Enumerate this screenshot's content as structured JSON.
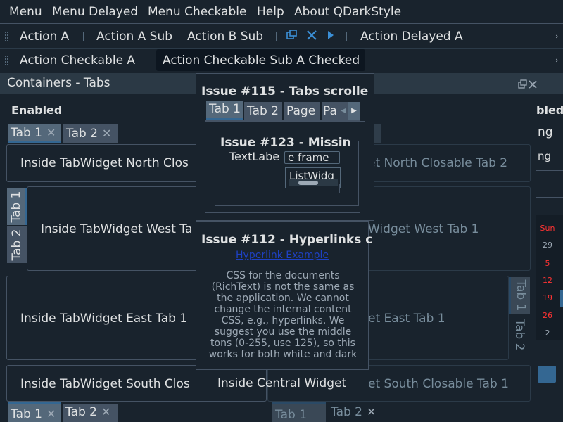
{
  "menubar": {
    "items": [
      "Menu",
      "Menu Delayed",
      "Menu Checkable",
      "Help",
      "About QDarkStyle"
    ]
  },
  "toolbar1": {
    "items": [
      "Action A",
      "Action A Sub",
      "Action B Sub",
      "Action Delayed A"
    ]
  },
  "toolbar2": {
    "items": [
      "Action Checkable A",
      "Action Checkable Sub A Checked"
    ]
  },
  "dock": {
    "title": "Containers - Tabs"
  },
  "left": {
    "section": "Enabled",
    "north": {
      "tabs": [
        "Tab 1",
        "Tab 2"
      ],
      "content": "Inside TabWidget North Clos"
    },
    "west": {
      "tabs": [
        "Tab 1",
        "Tab 2"
      ],
      "content": "Inside TabWidget West Ta"
    },
    "east": {
      "content": "Inside TabWidget East Tab 1"
    },
    "south": {
      "tabs": [
        "Tab 1",
        "Tab 2"
      ],
      "content": "Inside TabWidget South Clos"
    }
  },
  "right": {
    "section": "bled",
    "fragments": [
      "ng",
      "ng"
    ],
    "north": {
      "content": "et North Closable Tab 2"
    },
    "west": {
      "content": "Widget West Tab 1"
    },
    "east": {
      "tabs": [
        "Tab 1",
        "Tab 2"
      ],
      "content": "et East Tab 1"
    },
    "south": {
      "tabs": [
        "Tab 1",
        "Tab 2"
      ],
      "content": "et South Closable Tab 1"
    },
    "calendar": [
      "Sun",
      "29",
      "5",
      "12",
      "19",
      "26",
      "2"
    ]
  },
  "central": {
    "label": "Inside Central Widget"
  },
  "float115": {
    "title": "Issue #115 - Tabs scrolle",
    "tabs": [
      "Tab 1",
      "Tab 2",
      "Page",
      "Pa"
    ]
  },
  "float123": {
    "title": "Issue #123 - Missin",
    "label": "TextLabe",
    "field": "e frame",
    "list": "ListWidg"
  },
  "float112": {
    "title": "Issue #112 - Hyperlinks c",
    "link": "Hyperlink Example",
    "doc_lines": [
      "CSS for the documents",
      "(RichText) is not the same as",
      "the application. We cannot",
      "change the internal content",
      "CSS, e.g., hyperlinks. We",
      "suggest you use the middle",
      "tons (0-255, use 125), so this",
      "works for both white and dark"
    ]
  },
  "icons": [
    "float-icon",
    "close-icon",
    "play-icon"
  ],
  "colors": {
    "bg": "#19232D",
    "tab": "#455364",
    "accent": "#346792",
    "link": "#1E41C3",
    "weekend": "#FF3333"
  }
}
